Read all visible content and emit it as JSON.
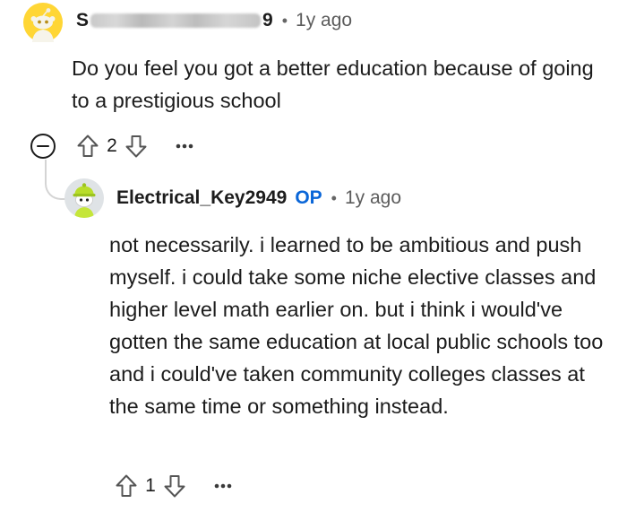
{
  "parent_comment": {
    "username_start": "S",
    "username_end": "9",
    "separator": "•",
    "time": "1y ago",
    "body": "Do you feel you got a better education because of going to a prestigious school",
    "vote_count": "2",
    "avatar_color": "#FFD635",
    "icons": [
      "collapse-icon",
      "upvote-icon",
      "downvote-icon",
      "more-options-icon"
    ]
  },
  "reply": {
    "username": "Electrical_Key2949",
    "op_label": "OP",
    "separator": "•",
    "time": "1y ago",
    "body": "not necessarily. i learned to be ambitious and push myself. i could take some niche elective classes and higher level math earlier on. but i think i would've gotten the same education at local public schools too and i could've taken community colleges classes at the same time or something instead.",
    "vote_count": "1",
    "op_color": "#0A66D8",
    "icons": [
      "upvote-icon",
      "downvote-icon",
      "more-options-icon"
    ]
  }
}
